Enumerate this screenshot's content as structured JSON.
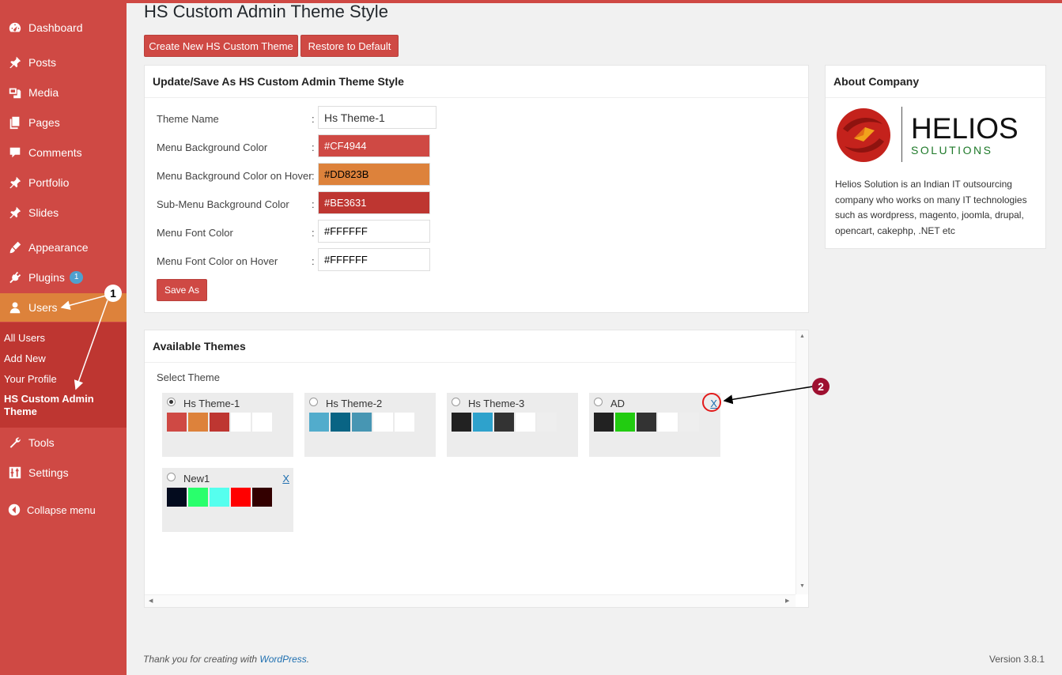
{
  "colors": {
    "menu_bg": "#CF4944",
    "menu_hover": "#DD823B",
    "submenu_bg": "#BE3631",
    "link": "#1E6FB0"
  },
  "sidebar": {
    "items": [
      {
        "label": "Dashboard",
        "icon": "dashboard-icon"
      },
      {
        "label": "Posts",
        "icon": "pin-icon"
      },
      {
        "label": "Media",
        "icon": "media-icon"
      },
      {
        "label": "Pages",
        "icon": "pages-icon"
      },
      {
        "label": "Comments",
        "icon": "comment-icon"
      },
      {
        "label": "Portfolio",
        "icon": "portfolio-icon"
      },
      {
        "label": "Slides",
        "icon": "slides-icon"
      },
      {
        "label": "Appearance",
        "icon": "brush-icon"
      },
      {
        "label": "Plugins",
        "icon": "plug-icon",
        "badge": "1"
      },
      {
        "label": "Users",
        "icon": "user-icon"
      },
      {
        "label": "Tools",
        "icon": "wrench-icon"
      },
      {
        "label": "Settings",
        "icon": "settings-icon"
      }
    ],
    "submenu": [
      "All Users",
      "Add New",
      "Your Profile",
      "HS Custom Admin Theme"
    ],
    "collapse": "Collapse menu"
  },
  "page": {
    "title": "HS Custom Admin Theme Style",
    "create_button": "Create New HS Custom Theme",
    "restore_button": "Restore to Default"
  },
  "form": {
    "heading": "Update/Save As HS Custom Admin Theme Style",
    "fields": [
      {
        "label": "Theme Name",
        "value": "Hs Theme-1",
        "bg": "#FFFFFF",
        "fg": "#333333"
      },
      {
        "label": "Menu Background Color",
        "value": "#CF4944",
        "bg": "#CF4944",
        "fg": "#FFFFFF"
      },
      {
        "label": "Menu Background Color on Hover",
        "value": "#DD823B",
        "bg": "#DD823B",
        "fg": "#000000"
      },
      {
        "label": "Sub-Menu Background Color",
        "value": "#BE3631",
        "bg": "#BE3631",
        "fg": "#FFFFFF"
      },
      {
        "label": "Menu Font Color",
        "value": "#FFFFFF",
        "bg": "#FFFFFF",
        "fg": "#000000"
      },
      {
        "label": "Menu Font Color on Hover",
        "value": "#FFFFFF",
        "bg": "#FFFFFF",
        "fg": "#000000"
      }
    ],
    "colon": ":",
    "save_button": "Save As"
  },
  "themes": {
    "heading": "Available Themes",
    "select_label": "Select Theme",
    "delete_label": "X",
    "items": [
      {
        "name": "Hs Theme-1",
        "selected": true,
        "deletable": false,
        "swatches": [
          "#CF4944",
          "#DD823B",
          "#BE3631",
          "#FFFFFF",
          "#FFFFFF"
        ]
      },
      {
        "name": "Hs Theme-2",
        "selected": false,
        "deletable": false,
        "swatches": [
          "#52ACCC",
          "#096484",
          "#4796B3",
          "#FFFFFF",
          "#FFFFFF"
        ]
      },
      {
        "name": "Hs Theme-3",
        "selected": false,
        "deletable": false,
        "swatches": [
          "#222222",
          "#2EA2CC",
          "#333333",
          "#FFFFFF",
          "#EEEEEE"
        ]
      },
      {
        "name": "AD",
        "selected": false,
        "deletable": true,
        "swatches": [
          "#222222",
          "#22CC11",
          "#333333",
          "#FFFFFF",
          "#EEEEEE"
        ]
      },
      {
        "name": "New1",
        "selected": false,
        "deletable": true,
        "swatches": [
          "#030B1E",
          "#29FF6C",
          "#55FFEE",
          "#FF0000",
          "#330000"
        ]
      }
    ]
  },
  "about": {
    "heading": "About Company",
    "logo_main": "HELIOS",
    "logo_sub": "SOLUTIONS",
    "text": "Helios Solution is an Indian IT outsourcing company who works on many IT technologies such as wordpress, magento, joomla, drupal, opencart, cakephp, .NET etc"
  },
  "footer": {
    "thanks_prefix": "Thank you for creating with ",
    "thanks_link": "WordPress",
    "thanks_suffix": ".",
    "version": "Version 3.8.1"
  },
  "annotations": {
    "marker1": "1",
    "marker2": "2"
  }
}
